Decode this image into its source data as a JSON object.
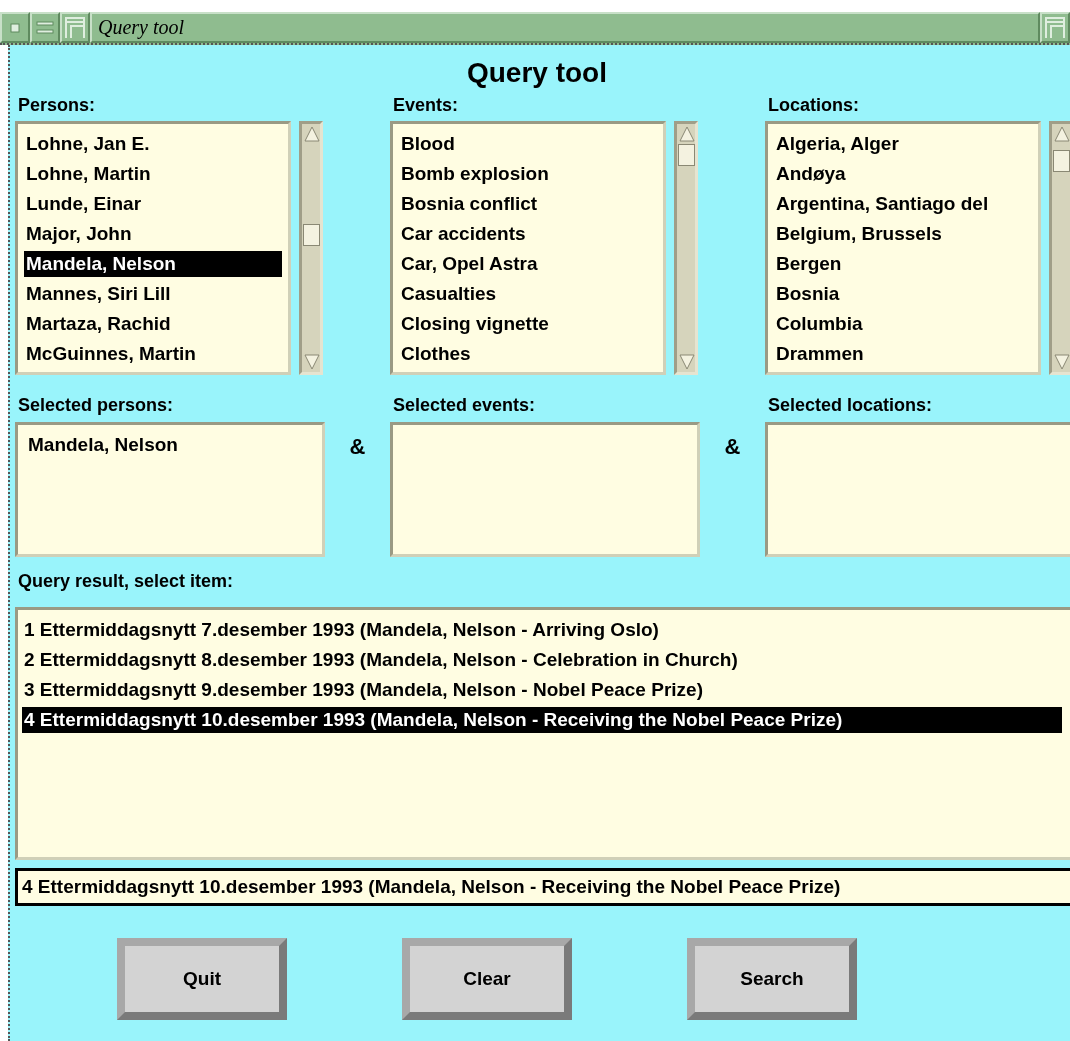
{
  "window": {
    "title": "Query tool"
  },
  "heading": "Query tool",
  "lists": [
    {
      "label": "Persons:",
      "items": [
        {
          "text": "Lohne, Jan E.",
          "selected": false
        },
        {
          "text": "Lohne, Martin",
          "selected": false
        },
        {
          "text": "Lunde, Einar",
          "selected": false
        },
        {
          "text": "Major, John",
          "selected": false
        },
        {
          "text": "Mandela, Nelson",
          "selected": true
        },
        {
          "text": "Mannes, Siri Lill",
          "selected": false
        },
        {
          "text": "Martaza, Rachid",
          "selected": false
        },
        {
          "text": "McGuinnes, Martin",
          "selected": false
        }
      ]
    },
    {
      "label": "Events:",
      "items": [
        {
          "text": "Blood",
          "selected": false
        },
        {
          "text": "Bomb explosion",
          "selected": false
        },
        {
          "text": "Bosnia conflict",
          "selected": false
        },
        {
          "text": "Car accidents",
          "selected": false
        },
        {
          "text": "Car, Opel Astra",
          "selected": false
        },
        {
          "text": "Casualties",
          "selected": false
        },
        {
          "text": "Closing vignette",
          "selected": false
        },
        {
          "text": "Clothes",
          "selected": false
        }
      ]
    },
    {
      "label": "Locations:",
      "items": [
        {
          "text": "Algeria, Alger",
          "selected": false
        },
        {
          "text": "Andøya",
          "selected": false
        },
        {
          "text": "Argentina, Santiago del",
          "selected": false
        },
        {
          "text": "Belgium, Brussels",
          "selected": false
        },
        {
          "text": "Bergen",
          "selected": false
        },
        {
          "text": "Bosnia",
          "selected": false
        },
        {
          "text": "Columbia",
          "selected": false
        },
        {
          "text": "Drammen",
          "selected": false
        }
      ]
    }
  ],
  "selected_lists": [
    {
      "label": "Selected persons:",
      "items": [
        "Mandela, Nelson"
      ],
      "operator": "&"
    },
    {
      "label": "Selected events:",
      "operator": "&"
    },
    {
      "label": "Selected locations:"
    }
  ],
  "results": {
    "label": "Query result, select item:",
    "rows": [
      {
        "text": "1 Ettermiddagsnytt 7.desember 1993 (Mandela, Nelson - Arriving Oslo)",
        "selected": false
      },
      {
        "text": "2 Ettermiddagsnytt 8.desember 1993 (Mandela, Nelson - Celebration in Church)",
        "selected": false
      },
      {
        "text": "3 Ettermiddagsnytt 9.desember 1993 (Mandela, Nelson - Nobel Peace Prize)",
        "selected": false
      },
      {
        "text": "4 Ettermiddagsnytt 10.desember 1993 (Mandela, Nelson - Receiving the Nobel Peace Prize)",
        "selected": true
      }
    ]
  },
  "selected_result": {
    "value": "4 Ettermiddagsnytt 10.desember 1993 (Mandela, Nelson - Receiving the Nobel Peace Prize)"
  },
  "buttons": [
    "Quit",
    "Clear",
    "Search"
  ]
}
